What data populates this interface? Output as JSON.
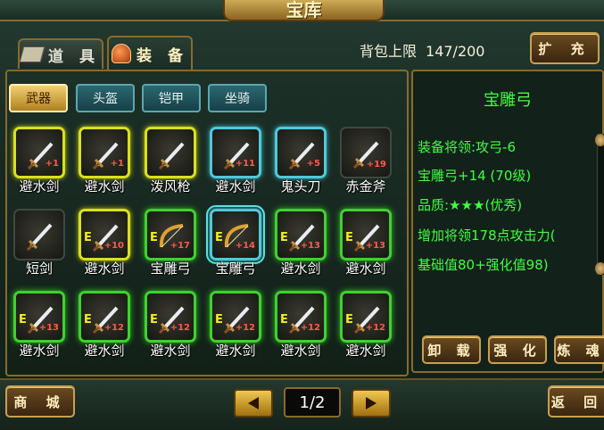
{
  "window": {
    "title": "宝库"
  },
  "tabs": [
    {
      "label": "道 具",
      "icon": "scroll-book-icon",
      "active": false
    },
    {
      "label": "装 备",
      "icon": "helmet-icon",
      "active": true
    }
  ],
  "bag": {
    "label": "背包上限",
    "value": "147/200",
    "expand_label": "扩 充"
  },
  "categories": [
    {
      "label": "武器",
      "active": true
    },
    {
      "label": "头盔",
      "active": false
    },
    {
      "label": "铠甲",
      "active": false
    },
    {
      "label": "坐骑",
      "active": false
    }
  ],
  "items": [
    {
      "name": "避水剑",
      "level": "+1",
      "e": "",
      "frame": "yellow"
    },
    {
      "name": "避水剑",
      "level": "+1",
      "e": "",
      "frame": "yellow"
    },
    {
      "name": "泼风枪",
      "level": "",
      "e": "",
      "frame": "yellow"
    },
    {
      "name": "避水剑",
      "level": "+11",
      "e": "",
      "frame": "cyan"
    },
    {
      "name": "鬼头刀",
      "level": "+5",
      "e": "",
      "frame": "cyan"
    },
    {
      "name": "赤金斧",
      "level": "+19",
      "e": "",
      "frame": "plain"
    },
    {
      "name": "短剑",
      "level": "",
      "e": "",
      "frame": "plain"
    },
    {
      "name": "避水剑",
      "level": "+10",
      "e": "E",
      "frame": "yellow"
    },
    {
      "name": "宝雕弓",
      "level": "+17",
      "e": "E",
      "frame": "green"
    },
    {
      "name": "宝雕弓",
      "level": "+14",
      "e": "E",
      "frame": "cyan"
    },
    {
      "name": "避水剑",
      "level": "+13",
      "e": "E",
      "frame": "green"
    },
    {
      "name": "避水剑",
      "level": "+13",
      "e": "E",
      "frame": "green"
    },
    {
      "name": "避水剑",
      "level": "+13",
      "e": "E",
      "frame": "green"
    },
    {
      "name": "避水剑",
      "level": "+12",
      "e": "E",
      "frame": "green"
    },
    {
      "name": "避水剑",
      "level": "+12",
      "e": "E",
      "frame": "green"
    },
    {
      "name": "避水剑",
      "level": "+12",
      "e": "E",
      "frame": "green"
    },
    {
      "name": "避水剑",
      "level": "+12",
      "e": "E",
      "frame": "green"
    },
    {
      "name": "避水剑",
      "level": "+12",
      "e": "E",
      "frame": "green"
    }
  ],
  "detail": {
    "title": "宝雕弓",
    "lines": [
      "装备将领:攻弓-6",
      "宝雕弓+14 (70级)",
      "品质:★★★(优秀)",
      "增加将领178点攻击力(",
      "基础值80+强化值98)"
    ],
    "buttons": [
      "卸 载",
      "强 化",
      "炼 魂"
    ]
  },
  "footer": {
    "shop_label": "商 城",
    "page": "1/2",
    "back_label": "返 回"
  },
  "colors": {
    "green_text": "#40ff40",
    "gold": "#c8a050"
  }
}
